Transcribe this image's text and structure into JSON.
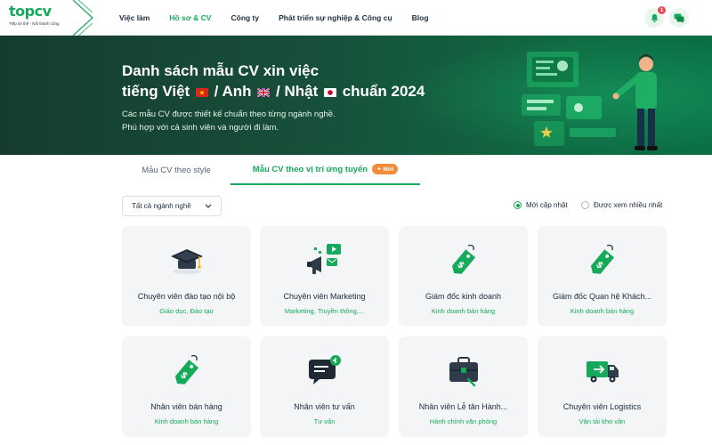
{
  "brand": {
    "logo": "topcv",
    "tagline": "Tiếp lợi thế - Nối thành công",
    "accent": "#15aa5a"
  },
  "nav": {
    "items": [
      {
        "label": "Việc làm",
        "active": false
      },
      {
        "label": "Hồ sơ & CV",
        "active": true
      },
      {
        "label": "Công ty",
        "active": false
      },
      {
        "label": "Phát triển sự nghiệp & Công cụ",
        "active": false
      },
      {
        "label": "Blog",
        "active": false
      }
    ],
    "notification_count": "1",
    "notification_icon": "bell-icon",
    "message_icon": "chat-icon"
  },
  "hero": {
    "title_line1": "Danh sách mẫu CV xin việc",
    "title_line2_a": "tiếng Việt",
    "title_line2_b": "/ Anh",
    "title_line2_c": "/ Nhật",
    "title_line2_d": "chuẩn 2024",
    "subtitle_line1": "Các mẫu CV được thiết kế chuẩn theo từng ngành nghề.",
    "subtitle_line2": "Phù hợp với cả sinh viên và người đi làm."
  },
  "tabs": {
    "style_label": "Mẫu CV theo style",
    "role_label": "Mẫu CV theo vị trí ứng tuyển",
    "new_badge": "✦ Mới",
    "active": "role"
  },
  "filter": {
    "industry_selected": "Tất cả ngành nghề",
    "sort_options": [
      {
        "label": "Mới cập nhật",
        "selected": true
      },
      {
        "label": "Được xem nhiều nhất",
        "selected": false
      }
    ]
  },
  "cards": [
    {
      "title": "Chuyên viên đào tạo nội bộ",
      "category": "Giáo dục, Đào tạo",
      "icon": "graduation-cap-icon"
    },
    {
      "title": "Chuyên viên Marketing",
      "category": "Marketing, Truyền thông,...",
      "icon": "megaphone-icon"
    },
    {
      "title": "Giám đốc kinh doanh",
      "category": "Kinh doanh bán hàng",
      "icon": "price-tag-icon"
    },
    {
      "title": "Giám đốc Quan hệ Khách...",
      "category": "Kinh doanh bán hàng",
      "icon": "price-tag-icon"
    },
    {
      "title": "Nhân viên bán hàng",
      "category": "Kinh doanh bán hàng",
      "icon": "price-tag-icon"
    },
    {
      "title": "Nhân viên tư vấn",
      "category": "Tư vấn",
      "icon": "chat-bubble-icon"
    },
    {
      "title": "Nhân viên Lễ tân Hành...",
      "category": "Hành chính văn phòng",
      "icon": "briefcase-icon"
    },
    {
      "title": "Chuyên viên Logistics",
      "category": "Vận tải kho vận",
      "icon": "delivery-truck-icon"
    }
  ]
}
